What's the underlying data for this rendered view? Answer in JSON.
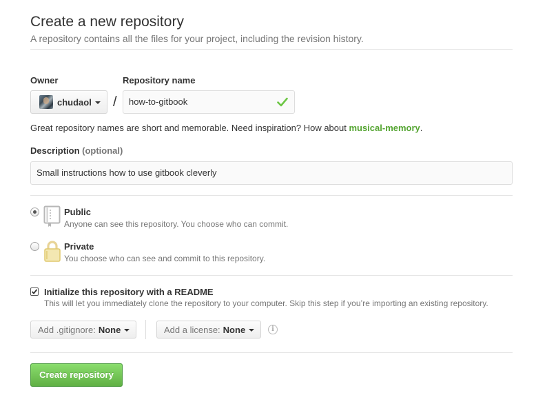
{
  "header": {
    "title": "Create a new repository",
    "subtitle": "A repository contains all the files for your project, including the revision history."
  },
  "owner": {
    "label": "Owner",
    "value": "chudaol"
  },
  "repo_name": {
    "label": "Repository name",
    "value": "how-to-gitbook",
    "valid": true
  },
  "separator": "/",
  "hint": {
    "text": "Great repository names are short and memorable. Need inspiration? How about ",
    "suggestion": "musical-memory",
    "end": "."
  },
  "description": {
    "label": "Description",
    "optional": "(optional)",
    "value": "Small instructions how to use gitbook cleverly"
  },
  "visibility": {
    "public": {
      "title": "Public",
      "note": "Anyone can see this repository. You choose who can commit.",
      "selected": true
    },
    "private": {
      "title": "Private",
      "note": "You choose who can see and commit to this repository.",
      "selected": false
    }
  },
  "readme": {
    "title": "Initialize this repository with a README",
    "note": "This will let you immediately clone the repository to your computer. Skip this step if you’re importing an existing repository.",
    "checked": true
  },
  "gitignore": {
    "label": "Add .gitignore:",
    "value": "None"
  },
  "license": {
    "label": "Add a license:",
    "value": "None"
  },
  "info_icon": "i",
  "submit": {
    "label": "Create repository"
  },
  "colors": {
    "accent_green": "#55a532",
    "button_green": "#60b044",
    "check_green": "#6cc644",
    "muted_text": "#767676"
  },
  "icons": {
    "owner_caret": "chevron-down-icon",
    "valid": "check-icon",
    "public": "repo-book-icon",
    "private": "lock-icon",
    "info": "info-icon"
  }
}
